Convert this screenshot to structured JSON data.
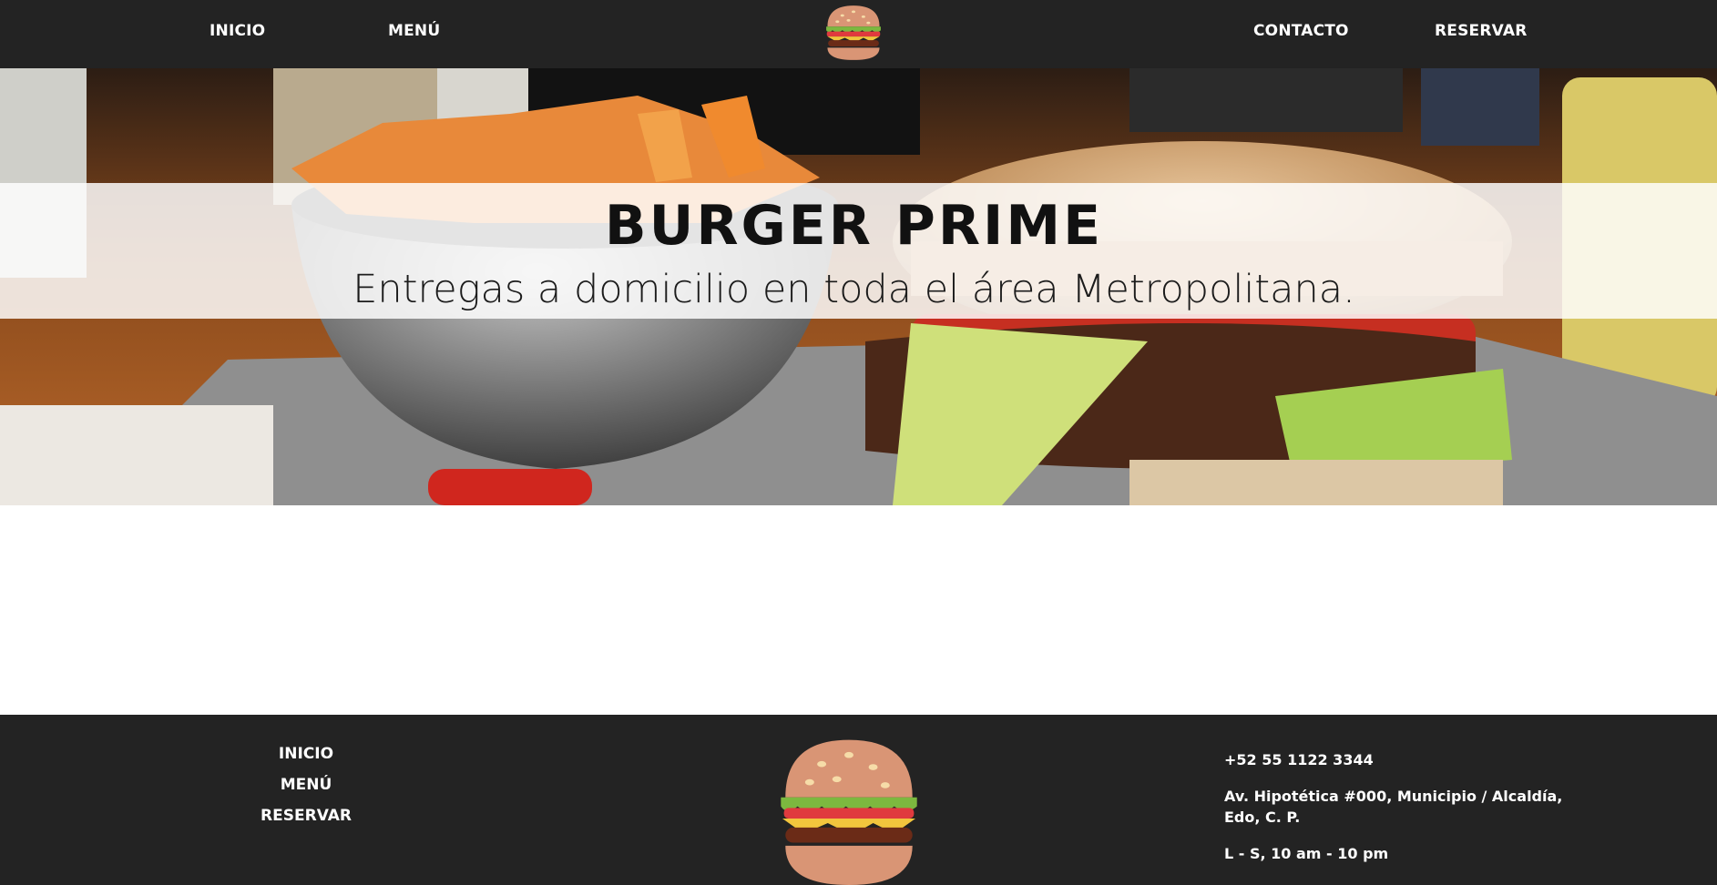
{
  "header": {
    "nav_left": [
      "INICIO",
      "MENÚ"
    ],
    "nav_right": [
      "CONTACTO",
      "RESERVAR"
    ],
    "logo_icon": "burger-icon"
  },
  "hero": {
    "title": "BURGER PRIME",
    "subtitle": "Entregas a domicilio en toda el área Metropolitana."
  },
  "footer": {
    "links": [
      "INICIO",
      "MENÚ",
      "RESERVAR"
    ],
    "logo_icon": "burger-icon",
    "phone": "+52 55 1122 3344",
    "address": "Av. Hipotética #000, Municipio / Alcaldía, Edo, C. P.",
    "hours": "L - S, 10 am - 10 pm"
  },
  "colors": {
    "bar_background": "#232323",
    "text_light": "#ffffff",
    "bun": "#d99575",
    "lettuce": "#7cb83f",
    "tomato": "#e03a3e",
    "cheese": "#f2c53d",
    "patty": "#6b2b17"
  }
}
